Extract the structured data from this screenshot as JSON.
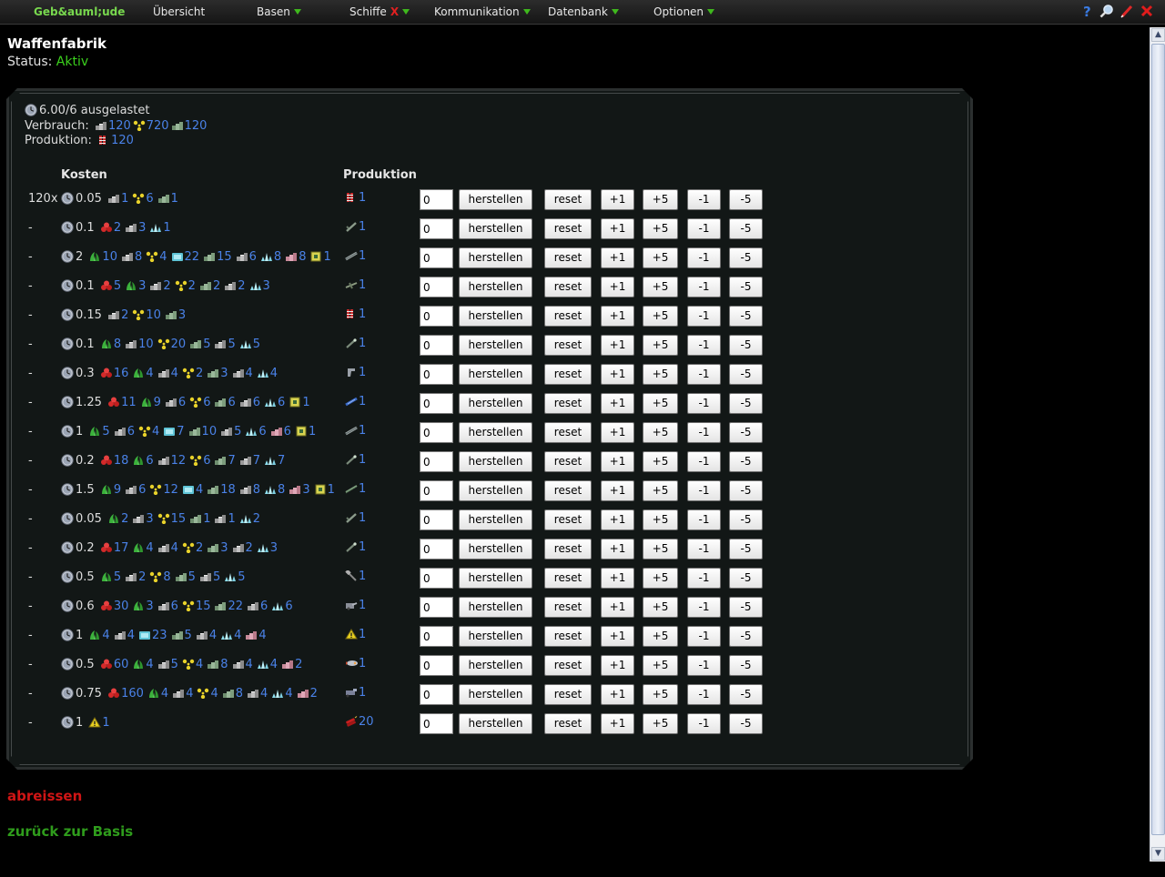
{
  "menu": {
    "items": [
      {
        "label": "Geb&auml;ude",
        "x_key": "home"
      },
      {
        "label": "Übersicht"
      },
      {
        "label": "Basen"
      },
      {
        "label": "Schiffe"
      },
      {
        "label": "Kommunikation"
      },
      {
        "label": "Datenbank"
      },
      {
        "label": "Optionen"
      }
    ],
    "schiffe_alert": "X"
  },
  "top_icons": [
    "help-icon",
    "search-icon",
    "edit-icon",
    "close-icon"
  ],
  "page": {
    "title": "Waffenfabrik",
    "status_label": "Status:",
    "status_value": "Aktiv"
  },
  "summary": {
    "load": "6.00/6 ausgelastet",
    "consumption_label": "Verbrauch:",
    "consumption": [
      {
        "icon": "metal",
        "value": "120"
      },
      {
        "icon": "uran",
        "value": "720"
      },
      {
        "icon": "plastic",
        "value": "120"
      }
    ],
    "production_label": "Produktion:",
    "production": [
      {
        "icon": "ammo-belt",
        "value": "120"
      }
    ]
  },
  "columns": {
    "costs": "Kosten",
    "production": "Produktion"
  },
  "button_labels": {
    "make": "herstellen",
    "reset": "reset",
    "plus1": "+1",
    "plus5": "+5",
    "minus1": "-1",
    "minus5": "-5"
  },
  "recipes": [
    {
      "label": "120x",
      "time": "0.05",
      "costs": [
        [
          "metal",
          "1"
        ],
        [
          "uran",
          "6"
        ],
        [
          "plastic",
          "1"
        ]
      ],
      "product": [
        "ammo-belt",
        "1"
      ],
      "qty": "0"
    },
    {
      "label": "-",
      "time": "0.1",
      "costs": [
        [
          "red-ore",
          "2"
        ],
        [
          "metal",
          "3"
        ],
        [
          "crystal",
          "1"
        ]
      ],
      "product": [
        "rifle",
        "1"
      ],
      "qty": "0"
    },
    {
      "label": "-",
      "time": "2",
      "costs": [
        [
          "plant",
          "10"
        ],
        [
          "metal",
          "8"
        ],
        [
          "uran",
          "4"
        ],
        [
          "cyan-cell",
          "22"
        ],
        [
          "plastic",
          "15"
        ],
        [
          "metal",
          "6"
        ],
        [
          "crystal",
          "8"
        ],
        [
          "pink-block",
          "8"
        ],
        [
          "chip",
          "1"
        ]
      ],
      "product": [
        "cannon",
        "1"
      ],
      "qty": "0"
    },
    {
      "label": "-",
      "time": "0.1",
      "costs": [
        [
          "red-ore",
          "5"
        ],
        [
          "plant",
          "3"
        ],
        [
          "metal",
          "2"
        ],
        [
          "uran",
          "2"
        ],
        [
          "plastic",
          "2"
        ],
        [
          "metal",
          "2"
        ],
        [
          "crystal",
          "3"
        ]
      ],
      "product": [
        "blaster",
        "1"
      ],
      "qty": "0"
    },
    {
      "label": "-",
      "time": "0.15",
      "costs": [
        [
          "metal",
          "2"
        ],
        [
          "uran",
          "10"
        ],
        [
          "plastic",
          "3"
        ]
      ],
      "product": [
        "ammo-belt",
        "1"
      ],
      "qty": "0"
    },
    {
      "label": "-",
      "time": "0.1",
      "costs": [
        [
          "plant",
          "8"
        ],
        [
          "metal",
          "10"
        ],
        [
          "uran",
          "20"
        ],
        [
          "plastic",
          "5"
        ],
        [
          "metal",
          "5"
        ],
        [
          "crystal",
          "5"
        ]
      ],
      "product": [
        "laser",
        "1"
      ],
      "qty": "0"
    },
    {
      "label": "-",
      "time": "0.3",
      "costs": [
        [
          "red-ore",
          "16"
        ],
        [
          "plant",
          "4"
        ],
        [
          "metal",
          "4"
        ],
        [
          "uran",
          "2"
        ],
        [
          "plastic",
          "3"
        ],
        [
          "metal",
          "4"
        ],
        [
          "crystal",
          "4"
        ]
      ],
      "product": [
        "pistol",
        "1"
      ],
      "qty": "0"
    },
    {
      "label": "-",
      "time": "1.25",
      "costs": [
        [
          "red-ore",
          "11"
        ],
        [
          "plant",
          "9"
        ],
        [
          "metal",
          "6"
        ],
        [
          "uran",
          "6"
        ],
        [
          "plastic",
          "6"
        ],
        [
          "metal",
          "6"
        ],
        [
          "crystal",
          "6"
        ],
        [
          "chip",
          "1"
        ]
      ],
      "product": [
        "blue-gun",
        "1"
      ],
      "qty": "0"
    },
    {
      "label": "-",
      "time": "1",
      "costs": [
        [
          "plant",
          "5"
        ],
        [
          "metal",
          "6"
        ],
        [
          "uran",
          "4"
        ],
        [
          "cyan-cell",
          "7"
        ],
        [
          "plastic",
          "10"
        ],
        [
          "metal",
          "5"
        ],
        [
          "crystal",
          "6"
        ],
        [
          "pink-block",
          "6"
        ],
        [
          "chip",
          "1"
        ]
      ],
      "product": [
        "cannon",
        "1"
      ],
      "qty": "0"
    },
    {
      "label": "-",
      "time": "0.2",
      "costs": [
        [
          "red-ore",
          "18"
        ],
        [
          "plant",
          "6"
        ],
        [
          "metal",
          "12"
        ],
        [
          "uran",
          "6"
        ],
        [
          "plastic",
          "7"
        ],
        [
          "metal",
          "7"
        ],
        [
          "crystal",
          "7"
        ]
      ],
      "product": [
        "laser",
        "1"
      ],
      "qty": "0"
    },
    {
      "label": "-",
      "time": "1.5",
      "costs": [
        [
          "plant",
          "9"
        ],
        [
          "metal",
          "6"
        ],
        [
          "uran",
          "12"
        ],
        [
          "cyan-cell",
          "4"
        ],
        [
          "plastic",
          "18"
        ],
        [
          "metal",
          "8"
        ],
        [
          "crystal",
          "8"
        ],
        [
          "pink-block",
          "3"
        ],
        [
          "chip",
          "1"
        ]
      ],
      "product": [
        "rail",
        "1"
      ],
      "qty": "0"
    },
    {
      "label": "-",
      "time": "0.05",
      "costs": [
        [
          "plant",
          "2"
        ],
        [
          "metal",
          "3"
        ],
        [
          "uran",
          "15"
        ],
        [
          "plastic",
          "1"
        ],
        [
          "metal",
          "1"
        ],
        [
          "crystal",
          "2"
        ]
      ],
      "product": [
        "rifle",
        "1"
      ],
      "qty": "0"
    },
    {
      "label": "-",
      "time": "0.2",
      "costs": [
        [
          "red-ore",
          "17"
        ],
        [
          "plant",
          "4"
        ],
        [
          "metal",
          "4"
        ],
        [
          "uran",
          "2"
        ],
        [
          "plastic",
          "3"
        ],
        [
          "metal",
          "2"
        ],
        [
          "crystal",
          "3"
        ]
      ],
      "product": [
        "laser",
        "1"
      ],
      "qty": "0"
    },
    {
      "label": "-",
      "time": "0.5",
      "costs": [
        [
          "plant",
          "5"
        ],
        [
          "metal",
          "2"
        ],
        [
          "uran",
          "8"
        ],
        [
          "plastic",
          "5"
        ],
        [
          "metal",
          "5"
        ],
        [
          "crystal",
          "5"
        ]
      ],
      "product": [
        "hammer",
        "1"
      ],
      "qty": "0"
    },
    {
      "label": "-",
      "time": "0.6",
      "costs": [
        [
          "red-ore",
          "30"
        ],
        [
          "plant",
          "3"
        ],
        [
          "metal",
          "6"
        ],
        [
          "uran",
          "15"
        ],
        [
          "plastic",
          "22"
        ],
        [
          "metal",
          "6"
        ],
        [
          "crystal",
          "6"
        ]
      ],
      "product": [
        "turret",
        "1"
      ],
      "qty": "0"
    },
    {
      "label": "-",
      "time": "1",
      "costs": [
        [
          "plant",
          "4"
        ],
        [
          "metal",
          "4"
        ],
        [
          "cyan-cell",
          "23"
        ],
        [
          "plastic",
          "5"
        ],
        [
          "metal",
          "4"
        ],
        [
          "crystal",
          "4"
        ],
        [
          "pink-block",
          "4"
        ]
      ],
      "product": [
        "warning",
        "1"
      ],
      "qty": "0"
    },
    {
      "label": "-",
      "time": "0.5",
      "costs": [
        [
          "red-ore",
          "60"
        ],
        [
          "plant",
          "4"
        ],
        [
          "metal",
          "5"
        ],
        [
          "uran",
          "4"
        ],
        [
          "plastic",
          "8"
        ],
        [
          "metal",
          "4"
        ],
        [
          "crystal",
          "4"
        ],
        [
          "pink-block",
          "2"
        ]
      ],
      "product": [
        "missile",
        "1"
      ],
      "qty": "0"
    },
    {
      "label": "-",
      "time": "0.75",
      "costs": [
        [
          "red-ore",
          "160"
        ],
        [
          "plant",
          "4"
        ],
        [
          "metal",
          "4"
        ],
        [
          "uran",
          "4"
        ],
        [
          "plastic",
          "8"
        ],
        [
          "metal",
          "4"
        ],
        [
          "crystal",
          "4"
        ],
        [
          "pink-block",
          "2"
        ]
      ],
      "product": [
        "launcher",
        "1"
      ],
      "qty": "0"
    },
    {
      "label": "-",
      "time": "1",
      "costs": [
        [
          "warning",
          "1"
        ]
      ],
      "product": [
        "dynamite",
        "20"
      ],
      "qty": "0"
    }
  ],
  "footer": {
    "demolish": "abreissen",
    "back": "zurück zur Basis"
  }
}
